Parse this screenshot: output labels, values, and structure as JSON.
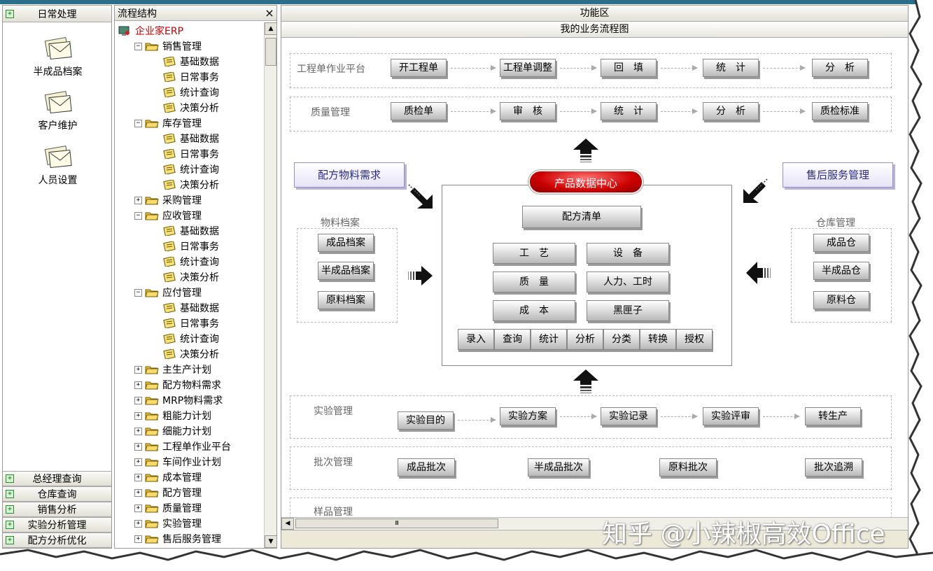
{
  "left_panel": {
    "header": "日常处理",
    "shortcuts": [
      "半成品档案",
      "客户维护",
      "人员设置"
    ],
    "bottom_items": [
      "总经理查询",
      "仓库查询",
      "销售分析",
      "实验分析管理",
      "配方分析优化"
    ]
  },
  "tree_panel": {
    "title": "流程结构",
    "close": "×",
    "root": "企业家ERP",
    "rows": [
      {
        "label": "销售管理",
        "level": 1,
        "expander": "−"
      },
      {
        "label": "基础数据",
        "level": 2
      },
      {
        "label": "日常事务",
        "level": 2
      },
      {
        "label": "统计查询",
        "level": 2
      },
      {
        "label": "决策分析",
        "level": 2
      },
      {
        "label": "库存管理",
        "level": 1,
        "expander": "−"
      },
      {
        "label": "基础数据",
        "level": 2
      },
      {
        "label": "日常事务",
        "level": 2
      },
      {
        "label": "统计查询",
        "level": 2
      },
      {
        "label": "决策分析",
        "level": 2
      },
      {
        "label": "采购管理",
        "level": 1,
        "expander": "+"
      },
      {
        "label": "应收管理",
        "level": 1,
        "expander": "−"
      },
      {
        "label": "基础数据",
        "level": 2
      },
      {
        "label": "日常事务",
        "level": 2
      },
      {
        "label": "统计查询",
        "level": 2
      },
      {
        "label": "决策分析",
        "level": 2
      },
      {
        "label": "应付管理",
        "level": 1,
        "expander": "−"
      },
      {
        "label": "基础数据",
        "level": 2
      },
      {
        "label": "日常事务",
        "level": 2
      },
      {
        "label": "统计查询",
        "level": 2
      },
      {
        "label": "决策分析",
        "level": 2
      },
      {
        "label": "主生产计划",
        "level": 1,
        "expander": "+"
      },
      {
        "label": "配方物料需求",
        "level": 1,
        "expander": "+"
      },
      {
        "label": "MRP物料需求",
        "level": 1,
        "expander": "+"
      },
      {
        "label": "粗能力计划",
        "level": 1,
        "expander": "+"
      },
      {
        "label": "细能力计划",
        "level": 1,
        "expander": "+"
      },
      {
        "label": "工程单作业平台",
        "level": 1,
        "expander": "+"
      },
      {
        "label": "车间作业计划",
        "level": 1,
        "expander": "+"
      },
      {
        "label": "成本管理",
        "level": 1,
        "expander": "+"
      },
      {
        "label": "配方管理",
        "level": 1,
        "expander": "+"
      },
      {
        "label": "质量管理",
        "level": 1,
        "expander": "+"
      },
      {
        "label": "实验管理",
        "level": 1,
        "expander": "+"
      },
      {
        "label": "售后服务管理",
        "level": 1,
        "expander": "+"
      }
    ]
  },
  "main": {
    "title": "功能区",
    "subtitle": "我的业务流程图",
    "row1": {
      "label": "工程单作业平台",
      "buttons": [
        "开工程单",
        "工程单调整",
        "回　填",
        "统　计",
        "分　析"
      ]
    },
    "row2": {
      "label": "质量管理",
      "buttons": [
        "质检单",
        "审　核",
        "统　计",
        "分　析",
        "质检标准"
      ]
    },
    "left_tag": "配方物料需求",
    "right_tag": "售后服务管理",
    "center_title": "产品数据中心",
    "center_main": "配方清单",
    "center_grid": [
      "工　艺",
      "设　备",
      "质　量",
      "人力、工时",
      "成　本",
      "黑匣子"
    ],
    "center_bar": [
      "录入",
      "查询",
      "统计",
      "分析",
      "分类",
      "转换",
      "授权"
    ],
    "material": {
      "label": "物料档案",
      "buttons": [
        "成品档案",
        "半成品档案",
        "原料档案"
      ]
    },
    "warehouse": {
      "label": "仓库管理",
      "buttons": [
        "成品仓",
        "半成品仓",
        "原料仓"
      ]
    },
    "row3": {
      "label": "实验管理",
      "buttons": [
        "实验目的",
        "实验方案",
        "实验记录",
        "实验评审",
        "转生产"
      ]
    },
    "row4": {
      "label": "批次管理",
      "buttons": [
        "成品批次",
        "半成品批次",
        "原料批次",
        "批次追溯"
      ]
    },
    "row5_label": "样品管理",
    "scroll_mark": "Ⅲ",
    "watermark": "知乎 @小辣椒高效Office"
  }
}
